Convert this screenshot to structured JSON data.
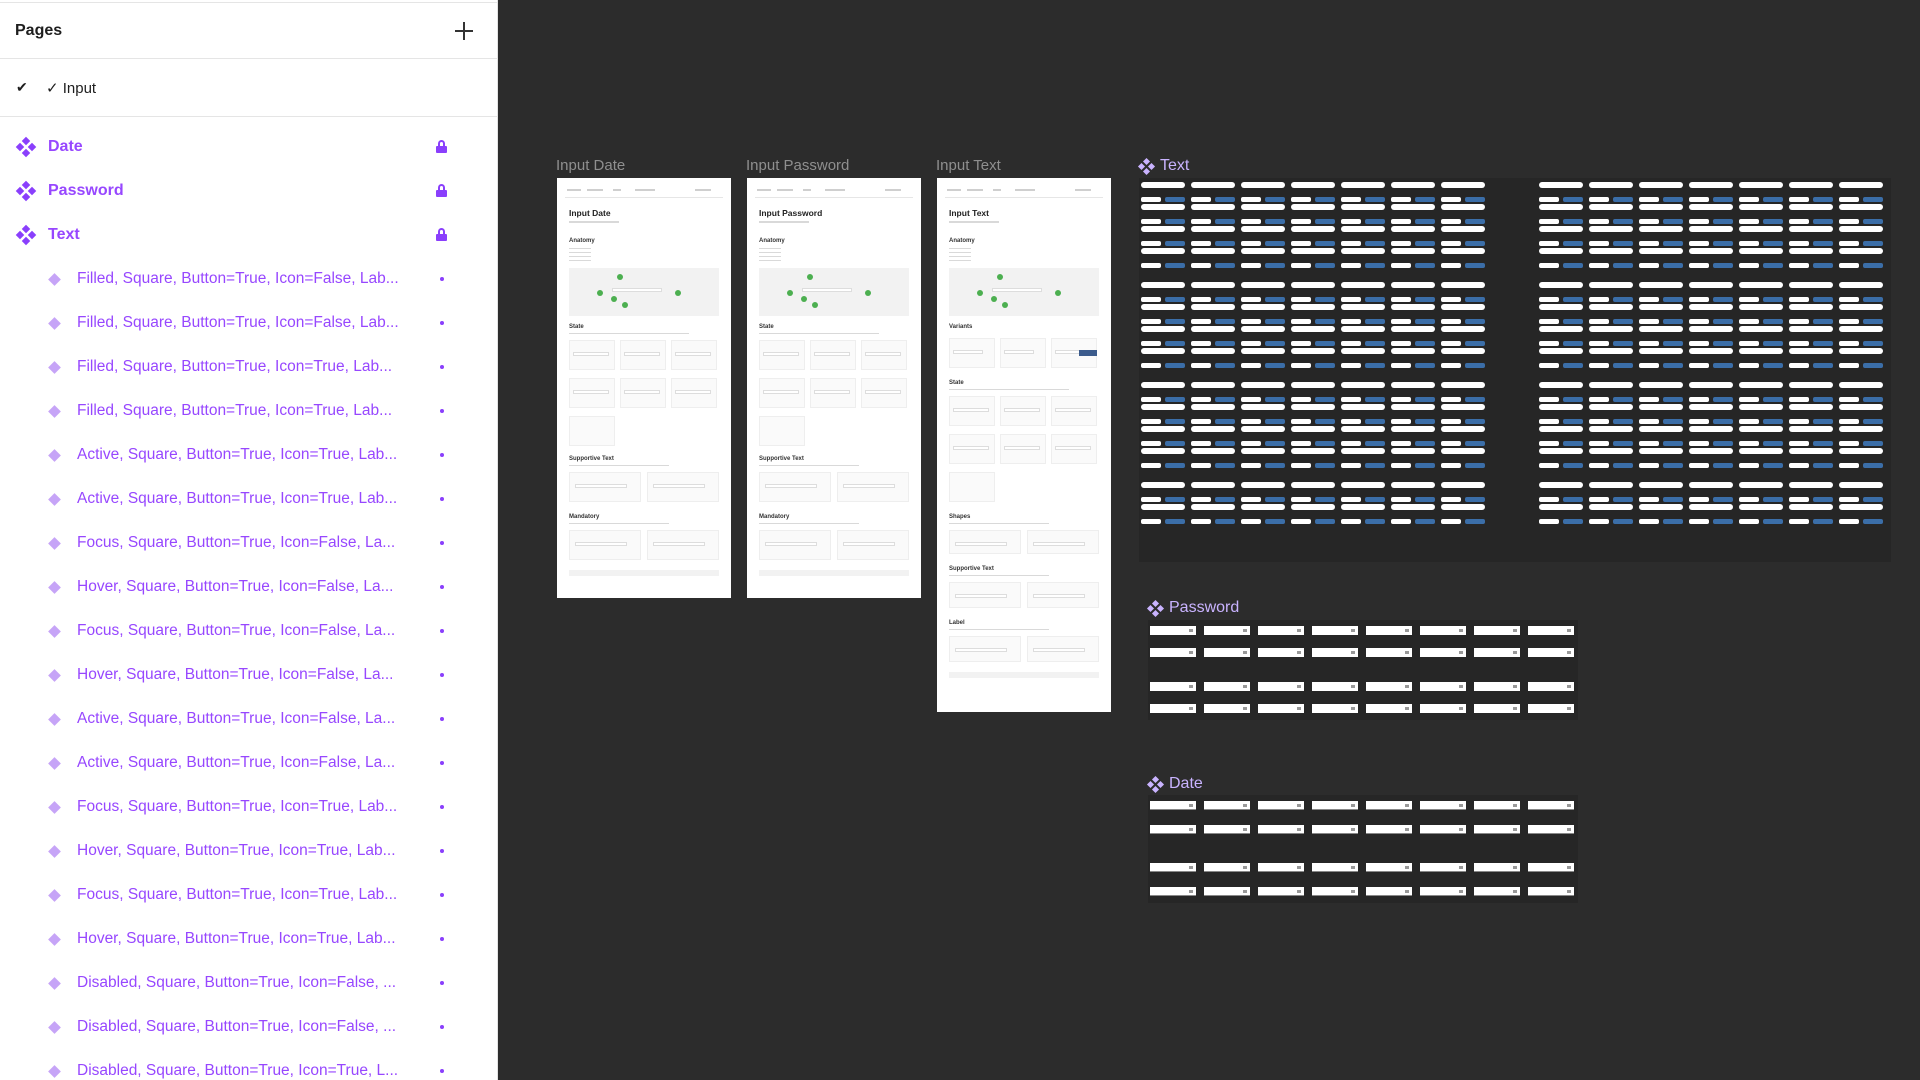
{
  "sidebar": {
    "title": "Pages",
    "add_icon": "plus-icon",
    "current_page": {
      "check": "✔",
      "name": "✓ Input"
    },
    "components": [
      {
        "label": "Date",
        "icon": "component-icon",
        "locked": true
      },
      {
        "label": "Password",
        "icon": "component-icon",
        "locked": true
      },
      {
        "label": "Text",
        "icon": "component-icon",
        "locked": true
      }
    ],
    "variants": [
      "Filled, Square, Button=True, Icon=False, Lab...",
      "Filled, Square, Button=True, Icon=False, Lab...",
      "Filled, Square, Button=True, Icon=True, Lab...",
      "Filled, Square, Button=True, Icon=True, Lab...",
      "Active, Square, Button=True, Icon=True, Lab...",
      "Active, Square, Button=True, Icon=True, Lab...",
      "Focus, Square, Button=True, Icon=False, La...",
      "Hover, Square, Button=True, Icon=False, La...",
      "Focus, Square, Button=True, Icon=False, La...",
      "Hover, Square, Button=True, Icon=False, La...",
      "Active, Square, Button=True, Icon=False, La...",
      "Active, Square, Button=True, Icon=False, La...",
      "Focus, Square, Button=True, Icon=True, Lab...",
      "Hover, Square, Button=True, Icon=True, Lab...",
      "Focus, Square, Button=True, Icon=True, Lab...",
      "Hover, Square, Button=True, Icon=True, Lab...",
      "Disabled, Square, Button=True, Icon=False, ...",
      "Disabled, Square, Button=True, Icon=False, ...",
      "Disabled, Square, Button=True, Icon=True, L..."
    ]
  },
  "canvas": {
    "frames": [
      {
        "label": "Input Date",
        "title": "Input Date",
        "sections": [
          "Anatomy",
          "State",
          "Supportive Text",
          "Mandatory"
        ]
      },
      {
        "label": "Input Password",
        "title": "Input Password",
        "sections": [
          "Anatomy",
          "State",
          "Supportive Text",
          "Mandatory"
        ]
      },
      {
        "label": "Input Text",
        "title": "Input Text",
        "sections": [
          "Anatomy",
          "Variants",
          "State",
          "Shapes",
          "Supportive Text",
          "Label"
        ]
      }
    ],
    "component_sets": [
      {
        "label": "Text",
        "icon": "component-icon"
      },
      {
        "label": "Password",
        "icon": "component-icon"
      },
      {
        "label": "Date",
        "icon": "component-icon"
      }
    ]
  },
  "colors": {
    "accent": "#9747ff",
    "canvas_bg": "#2c2c2c",
    "component_label": "#c9b3ff"
  }
}
